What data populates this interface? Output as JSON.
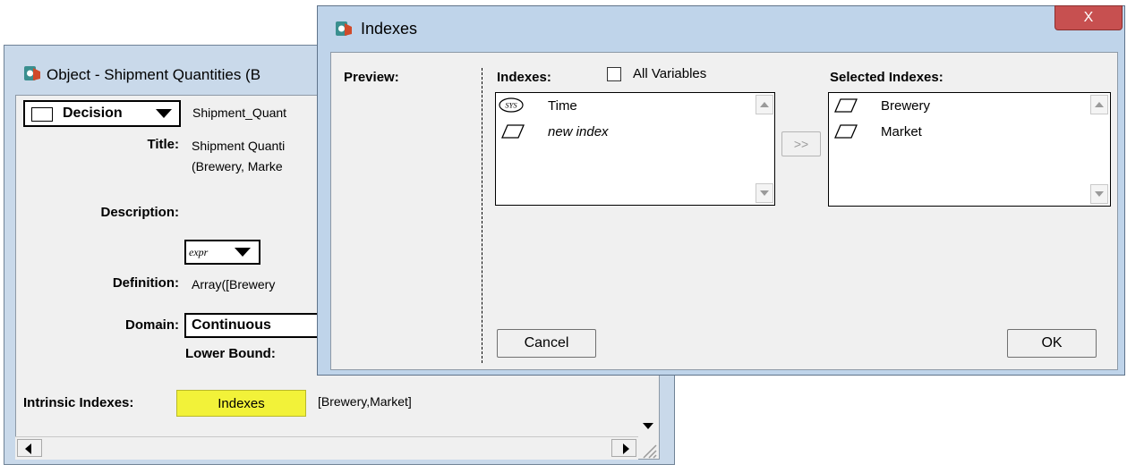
{
  "object_window": {
    "title": "Object - Shipment Quantities (B",
    "class_type": "Decision",
    "identifier": "Shipment_Quant",
    "title_label": "Title:",
    "title_value_line1": "Shipment Quanti",
    "title_value_line2": "(Brewery, Marke",
    "description_label": "Description:",
    "expr_menu": "expr",
    "definition_label": "Definition:",
    "definition_value": "Array([Brewery",
    "domain_label": "Domain:",
    "domain_value": "Continuous",
    "lower_bound_label": "Lower Bound:",
    "intrinsic_indexes_label": "Intrinsic Indexes:",
    "indexes_button": "Indexes",
    "intrinsic_indexes_value": "[Brewery,Market]"
  },
  "indexes_dialog": {
    "title": "Indexes",
    "close_glyph": "X",
    "preview_label": "Preview:",
    "indexes_label": "Indexes:",
    "all_variables_label": "All Variables",
    "all_variables_checked": false,
    "available_indexes": [
      {
        "badge": "SYS",
        "name": "Time",
        "italic": false
      },
      {
        "badge": "",
        "name": "new index",
        "italic": true
      }
    ],
    "move_button": ">>",
    "selected_label": "Selected Indexes:",
    "selected_indexes": [
      {
        "name": "Brewery"
      },
      {
        "name": "Market"
      }
    ],
    "cancel_button": "Cancel",
    "ok_button": "OK"
  },
  "colors": {
    "indexes_button_bg": "#f2f239",
    "close_button_bg": "#c75050",
    "frame_blue": "#bfd4ea"
  }
}
